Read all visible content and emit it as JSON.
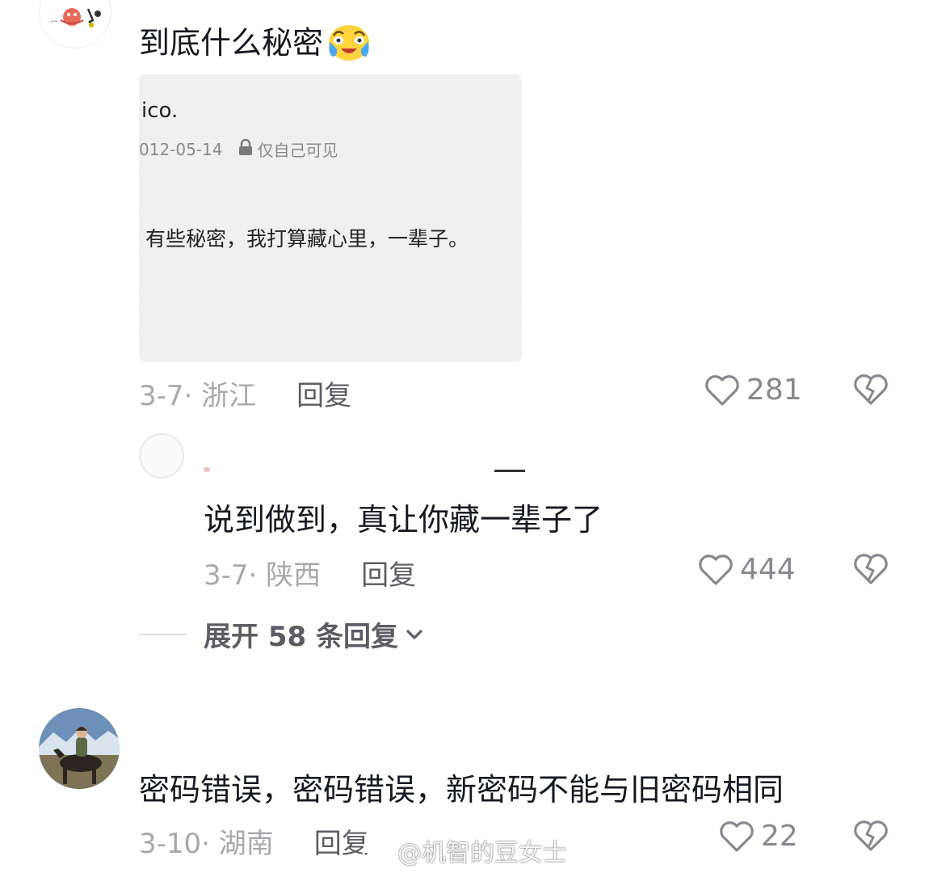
{
  "comments": [
    {
      "text": "到底什么秘密",
      "emoji": "crying-laughing-emoji",
      "date_location": "3-7· 浙江",
      "reply_label": "回复",
      "likes": "281",
      "screenshot": {
        "name": "ico.",
        "date": "012-05-14",
        "visibility": "仅自己可见",
        "body": "有些秘密，我打算藏心里，一辈子。"
      }
    },
    {
      "text": "说到做到，真让你藏一辈子了",
      "date_location": "3-7· 陕西",
      "reply_label": "回复",
      "likes": "444"
    },
    {
      "text": "密码错误，密码错误，新密码不能与旧密码相同",
      "date_location": "3-10· 湖南",
      "reply_label": "回复",
      "likes": "22"
    }
  ],
  "expand_replies": "展开 58 条回复",
  "watermark": "@机智的豆女士",
  "icons": {
    "like": "heart-outline-icon",
    "dislike": "broken-heart-icon",
    "lock": "lock-icon",
    "expand": "chevron-down-icon"
  },
  "colors": {
    "text": "#161823",
    "meta": "#a8a8ad",
    "reply": "#5c5c66",
    "icon": "#888892"
  }
}
